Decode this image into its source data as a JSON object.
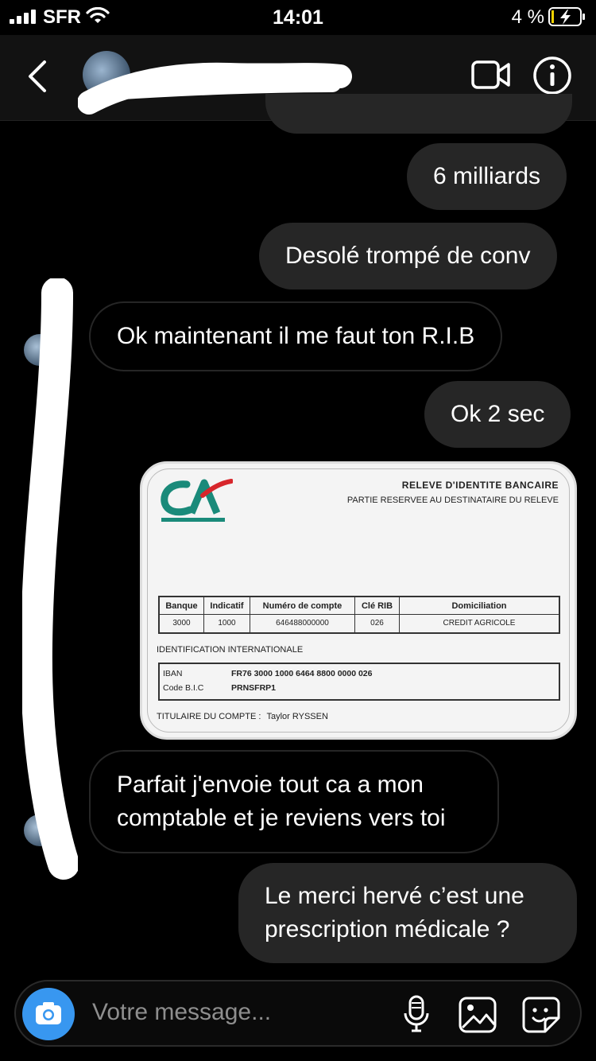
{
  "status_bar": {
    "carrier": "SFR",
    "time": "14:01",
    "battery": "4 %"
  },
  "header": {
    "back_icon": "chevron-left-icon",
    "video_icon": "video-camera-icon",
    "info_icon": "info-icon"
  },
  "messages": [
    {
      "side": "out",
      "text": "6 milliards"
    },
    {
      "side": "out",
      "text": "Desolé trompé de conv"
    },
    {
      "side": "in",
      "text": "Ok maintenant il me faut ton R.I.B"
    },
    {
      "side": "out",
      "text": "Ok 2 sec"
    },
    {
      "side": "in",
      "text": "Parfait j'envoie tout ca a mon comptable et je reviens vers toi"
    },
    {
      "side": "out",
      "text": "Le merci hervé c’est une prescription médicale ?"
    }
  ],
  "rib_image": {
    "title": "RELEVE D'IDENTITE BANCAIRE",
    "subtitle": "PARTIE RESERVEE AU DESTINATAIRE DU RELEVE",
    "logo": "CA",
    "table_headers": [
      "Banque",
      "Indicatif",
      "Numéro de compte",
      "Clé RIB",
      "Domiciliation"
    ],
    "table_values": [
      "3000",
      "1000",
      "646488000000",
      "026",
      "CREDIT AGRICOLE"
    ],
    "intl_label": "IDENTIFICATION INTERNATIONALE",
    "iban_label": "IBAN",
    "iban_value": "FR76 3000 1000 6464 8800 0000 026",
    "bic_label": "Code B.I.C",
    "bic_value": "PRNSFRP1",
    "holder_label": "TITULAIRE DU COMPTE :",
    "holder_value": "Taylor RYSSEN"
  },
  "composer": {
    "placeholder": "Votre message..."
  },
  "colors": {
    "accent": "#3897f0",
    "bubble": "#262626",
    "ca_green": "#1a8a7a",
    "ca_red": "#d7262b"
  }
}
